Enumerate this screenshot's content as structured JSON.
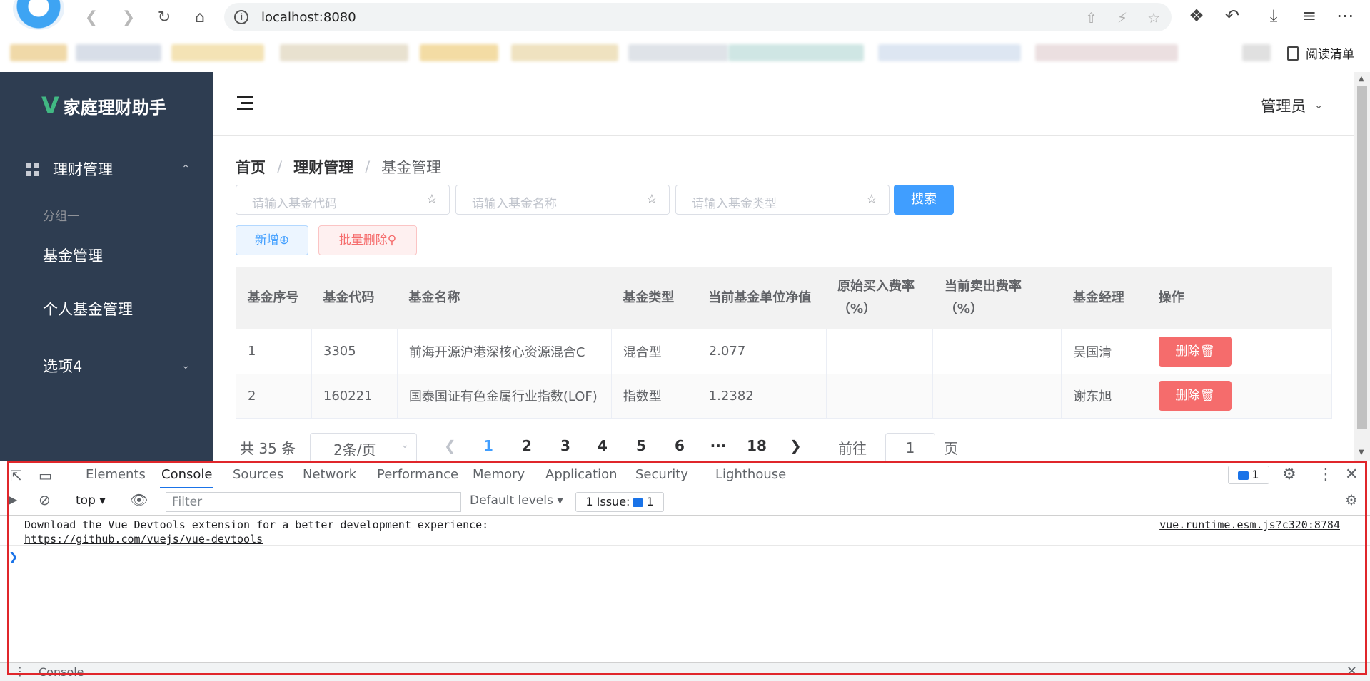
{
  "browser": {
    "url": "localhost:8080",
    "reading_list": "阅读清单"
  },
  "app": {
    "brand": "家庭理财助手",
    "brand_letter": "V",
    "sidebar": {
      "menu_finance": "理财管理",
      "group_title": "分组一",
      "item_fund": "基金管理",
      "item_personal_fund": "个人基金管理",
      "item_option4": "选项4"
    },
    "header": {
      "user": "管理员"
    },
    "breadcrumb": [
      "首页",
      "理财管理",
      "基金管理"
    ],
    "search": {
      "code_placeholder": "请输入基金代码",
      "name_placeholder": "请输入基金名称",
      "type_placeholder": "请输入基金类型",
      "button": "搜索"
    },
    "actions": {
      "add": "新增",
      "batch_delete": "批量删除"
    },
    "table": {
      "headers": [
        "基金序号",
        "基金代码",
        "基金名称",
        "基金类型",
        "当前基金单位净值",
        "原始买入费率（%）",
        "当前卖出费率（%）",
        "基金经理",
        "操作"
      ],
      "rows": [
        {
          "index": "1",
          "code": "3305",
          "name": "前海开源沪港深核心资源混合C",
          "type": "混合型",
          "nav": "2.077",
          "buy_fee": "",
          "sell_fee": "",
          "manager": "吴国清",
          "action": "删除"
        },
        {
          "index": "2",
          "code": "160221",
          "name": "国泰国证有色金属行业指数(LOF)",
          "type": "指数型",
          "nav": "1.2382",
          "buy_fee": "",
          "sell_fee": "",
          "manager": "谢东旭",
          "action": "删除"
        }
      ]
    },
    "pagination": {
      "total": "共 35 条",
      "page_size": "2条/页",
      "pages": [
        "1",
        "2",
        "3",
        "4",
        "5",
        "6",
        "···",
        "18"
      ],
      "current": "1",
      "goto_label": "前往",
      "goto_value": "1",
      "page_word": "页"
    }
  },
  "devtools": {
    "tabs": [
      "Elements",
      "Console",
      "Sources",
      "Network",
      "Performance",
      "Memory",
      "Application",
      "Security",
      "Lighthouse"
    ],
    "active_tab": "Console",
    "message_badge": "1",
    "context": "top",
    "filter_placeholder": "Filter",
    "levels": "Default levels",
    "issues": "1 Issue:",
    "issues_count": "1",
    "message_line1": "Download the Vue Devtools extension for a better development experience:",
    "message_line2": "https://github.com/vuejs/vue-devtools",
    "message_source": "vue.runtime.esm.js?c320:8784",
    "drawer_label": "Console"
  },
  "colors": {
    "sidebar": "#2e3d51",
    "primary": "#409eff",
    "danger": "#f56c6c",
    "highlight": "#e0262b"
  }
}
